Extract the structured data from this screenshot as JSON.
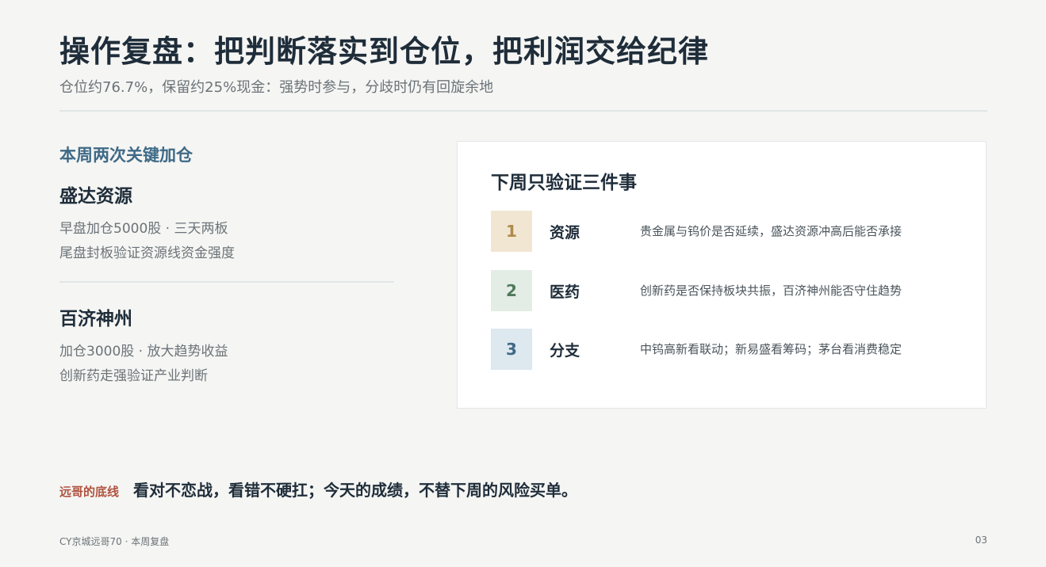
{
  "header": {
    "title": "操作复盘：把判断落实到仓位，把利润交给纪律",
    "subtitle": "仓位约76.7%，保留约25%现金：强势时参与，分歧时仍有回旋余地"
  },
  "left": {
    "heading": "本周两次关键加仓",
    "stocks": [
      {
        "name": "盛达资源",
        "line1": "早盘加仓5000股 · 三天两板",
        "line2": "尾盘封板验证资源线资金强度"
      },
      {
        "name": "百济神州",
        "line1": "加仓3000股 · 放大趋势收益",
        "line2": "创新药走强验证产业判断"
      }
    ]
  },
  "card": {
    "title": "下周只验证三件事",
    "items": [
      {
        "num": "1",
        "label": "资源",
        "desc": "贵金属与钨价是否延续，盛达资源冲高后能否承接",
        "badge_bg": "#f1e6d2",
        "badge_fg": "#b08a4c"
      },
      {
        "num": "2",
        "label": "医药",
        "desc": "创新药是否保持板块共振，百济神州能否守住趋势",
        "badge_bg": "#e3ede5",
        "badge_fg": "#4f7a5c"
      },
      {
        "num": "3",
        "label": "分支",
        "desc": "中钨高新看联动；新易盛看筹码；茅台看消费稳定",
        "badge_bg": "#dde8ef",
        "badge_fg": "#3e6a87"
      }
    ]
  },
  "bottom": {
    "tag": "远哥的底线",
    "text": "看对不恋战，看错不硬扛；今天的成绩，不替下周的风险买单。"
  },
  "footer": {
    "left": "CY京城远哥70 · 本周复盘",
    "page": "03"
  }
}
